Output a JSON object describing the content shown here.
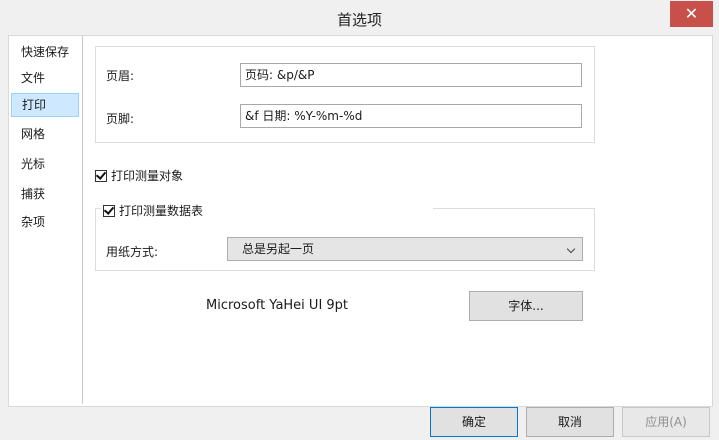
{
  "window": {
    "title": "首选项",
    "close_label": "✕"
  },
  "sidebar": {
    "items": [
      {
        "label": "快速保存"
      },
      {
        "label": "文件"
      },
      {
        "label": "打印"
      },
      {
        "label": "网格"
      },
      {
        "label": "光标"
      },
      {
        "label": "捕获"
      },
      {
        "label": "杂项"
      }
    ],
    "selected": "打印"
  },
  "header_footer": {
    "header_label": "页眉:",
    "header_value": "页码: &p/&P",
    "footer_label": "页脚:",
    "footer_value": "&f 日期: %Y-%m-%d"
  },
  "print_measure_objects": {
    "label": "打印测量对象",
    "checked": true
  },
  "print_measure_table": {
    "label": "打印测量数据表",
    "checked": true,
    "paper_mode_label": "用纸方式:",
    "paper_mode_value": "总是另起一页"
  },
  "font": {
    "current": "Microsoft YaHei UI 9pt",
    "button_label": "字体..."
  },
  "buttons": {
    "ok": "确定",
    "cancel": "取消",
    "apply": "应用(A)"
  }
}
